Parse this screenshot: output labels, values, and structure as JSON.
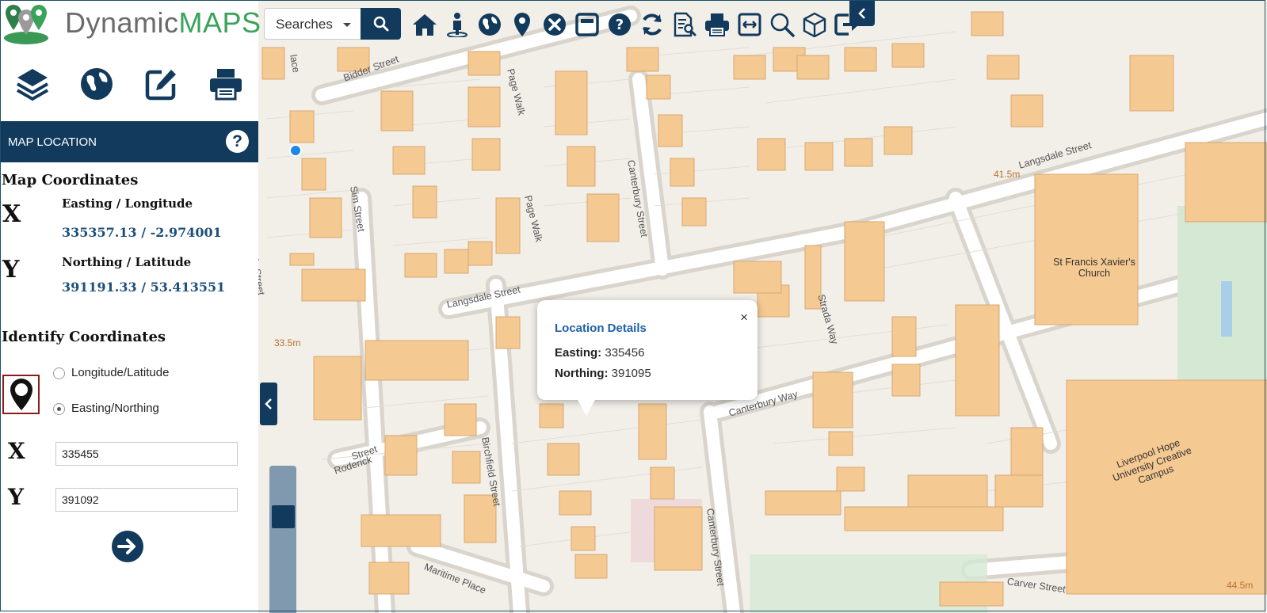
{
  "app": {
    "logo_part1": "Dynamic",
    "logo_part2": "MAPS"
  },
  "search": {
    "dropdown_label": "Searches"
  },
  "toolbar": {
    "icons": [
      "home-icon",
      "person-icon",
      "globe-icon",
      "map-pin-icon",
      "clear-icon",
      "window-icon",
      "help-icon",
      "refresh-icon",
      "report-search-icon",
      "print-icon",
      "fit-width-icon",
      "zoom-icon",
      "3d-cube-icon",
      "exit-icon"
    ]
  },
  "sidebar_tools": [
    "layers-icon",
    "globe-icon",
    "edit-icon",
    "print-icon"
  ],
  "panel": {
    "title": "MAP LOCATION",
    "help": "?"
  },
  "map_coordinates": {
    "heading": "Map Coordinates",
    "x_letter": "X",
    "y_letter": "Y",
    "x_label": "Easting / Longitude",
    "x_value": "335357.13 / -2.974001",
    "y_label": "Northing / Latitude",
    "y_value": "391191.33 / 53.413551"
  },
  "identify": {
    "heading": "Identify Coordinates",
    "option_lonlat": "Longitude/Latitude",
    "option_easting": "Easting/Northing",
    "selected": "Easting/Northing",
    "x_letter": "X",
    "y_letter": "Y",
    "x_value": "335455",
    "y_value": "391092"
  },
  "popup": {
    "title": "Location Details",
    "close": "×",
    "easting_label": "Easting:",
    "easting_value": "335456",
    "northing_label": "Northing:",
    "northing_value": "391095"
  },
  "map_labels": {
    "bidder": "Bidder Street",
    "page_walk_1": "Page Walk",
    "page_walk_2": "Page Walk",
    "sim": "Sim Street",
    "canterbury_1": "Canterbury Street",
    "canterbury_2": "Canterbury Street",
    "langsdale_1": "Langsdale Street",
    "langsdale_2": "Langsdale Street",
    "strada": "Strada Way",
    "canterbury_way": "Canterbury Way",
    "birchfield": "Birchfield Street",
    "roderick": "Roderick",
    "street": "Street",
    "maritime": "Maritime Place",
    "carver": "Carver Street",
    "lace": "lace",
    "st_street": "...ls Street",
    "elev_1": "41.5m",
    "elev_2": "33.5m",
    "elev_3": "44.5m",
    "church": "St Francis Xavier's Church",
    "campus": "Liverpool Hope University Creative Campus"
  }
}
